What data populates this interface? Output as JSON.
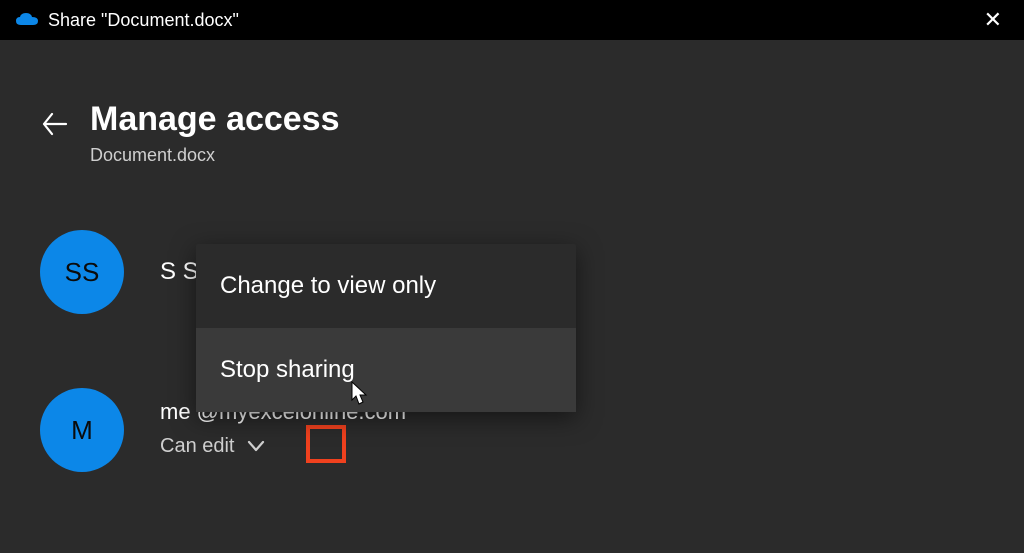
{
  "titlebar": {
    "title": "Share \"Document.docx\""
  },
  "header": {
    "title": "Manage access",
    "subtitle": "Document.docx"
  },
  "people": [
    {
      "initials": "SS",
      "name": "S Smith",
      "email": "",
      "permission": ""
    },
    {
      "initials": "M",
      "name": "",
      "email": "me @myexcelonline.com",
      "permission": "Can edit"
    }
  ],
  "menu": {
    "items": [
      {
        "label": "Change to view only",
        "hover": false
      },
      {
        "label": "Stop sharing",
        "hover": true
      }
    ]
  }
}
